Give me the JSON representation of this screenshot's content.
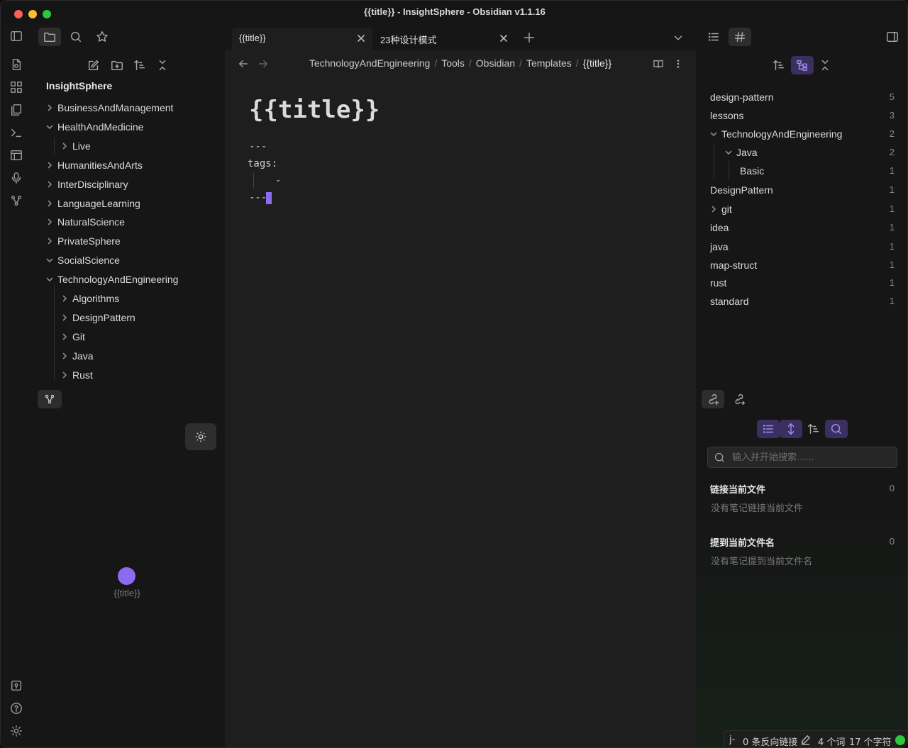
{
  "window": {
    "title": "{{title}} - InsightSphere - Obsidian v1.1.16"
  },
  "file_explorer": {
    "vault_name": "InsightSphere",
    "items": [
      {
        "label": "BusinessAndManagement",
        "expanded": false
      },
      {
        "label": "HealthAndMedicine",
        "expanded": true
      },
      {
        "label": "Live",
        "expanded": false
      },
      {
        "label": "HumanitiesAndArts",
        "expanded": false
      },
      {
        "label": "InterDisciplinary",
        "expanded": false
      },
      {
        "label": "LanguageLearning",
        "expanded": false
      },
      {
        "label": "NaturalScience",
        "expanded": false
      },
      {
        "label": "PrivateSphere",
        "expanded": false
      },
      {
        "label": "SocialScience",
        "expanded": true
      },
      {
        "label": "TechnologyAndEngineering",
        "expanded": true
      },
      {
        "label": "Algorithms",
        "expanded": false
      },
      {
        "label": "DesignPattern",
        "expanded": false
      },
      {
        "label": "Git",
        "expanded": false
      },
      {
        "label": "Java",
        "expanded": false
      },
      {
        "label": "Rust",
        "expanded": false
      }
    ]
  },
  "local_graph": {
    "node_label": "{{title}}"
  },
  "tabs": [
    {
      "label": "{{title}}",
      "active": true
    },
    {
      "label": "23种设计模式",
      "active": false
    }
  ],
  "editor": {
    "breadcrumb": [
      "TechnologyAndEngineering",
      "Tools",
      "Obsidian",
      "Templates",
      "{{title}}"
    ],
    "breadcrumb_sep": "/",
    "title": "{{title}}",
    "lines": [
      "---",
      "tags:",
      "  -",
      "---"
    ]
  },
  "tags_pane": {
    "tags": [
      {
        "label": "design-pattern",
        "count": "5"
      },
      {
        "label": "lessons",
        "count": "3"
      },
      {
        "label": "TechnologyAndEngineering",
        "count": "2"
      },
      {
        "label": "Java",
        "count": "2"
      },
      {
        "label": "Basic",
        "count": "1"
      },
      {
        "label": "DesignPattern",
        "count": "1"
      },
      {
        "label": "git",
        "count": "1"
      },
      {
        "label": "idea",
        "count": "1"
      },
      {
        "label": "java",
        "count": "1"
      },
      {
        "label": "map-struct",
        "count": "1"
      },
      {
        "label": "rust",
        "count": "1"
      },
      {
        "label": "standard",
        "count": "1"
      }
    ]
  },
  "backlinks": {
    "search_placeholder": "输入并开始搜索......",
    "linked_heading": "链接当前文件",
    "linked_count": "0",
    "linked_empty": "没有笔记链接当前文件",
    "unlinked_heading": "提到当前文件名",
    "unlinked_count": "0",
    "unlinked_empty": "没有笔记提到当前文件名"
  },
  "status_bar": {
    "mode": "j-",
    "backlinks": "0 条反向链接",
    "words": "4 个词",
    "chars": "17 个字符",
    "sync_color": "#2ec93a"
  },
  "colors": {
    "accent": "#8b6cf0"
  }
}
